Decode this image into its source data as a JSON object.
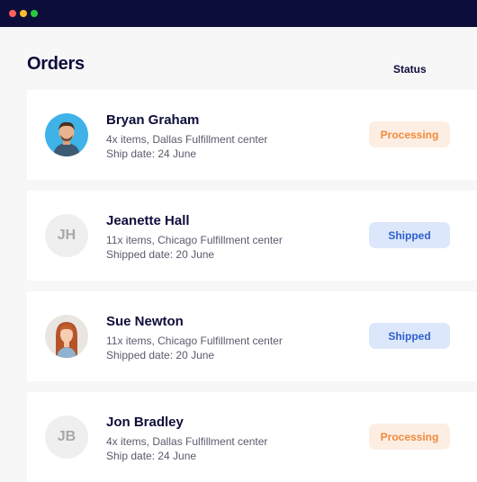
{
  "window": {
    "controls": [
      "close",
      "minimize",
      "maximize"
    ]
  },
  "header": {
    "title": "Orders",
    "status_column": "Status"
  },
  "orders": [
    {
      "name": "Bryan Graham",
      "items": "4x items, Dallas Fulfillment center",
      "date": "Ship date: 24 June",
      "status": "Processing",
      "status_color": "#f08a3c",
      "avatar": "photo-man"
    },
    {
      "name": "Jeanette Hall",
      "initials": "JH",
      "items": "11x items, Chicago Fulfillment center",
      "date": "Shipped date: 20 June",
      "status": "Shipped",
      "status_color": "#2f5fcc",
      "avatar": "initials"
    },
    {
      "name": "Sue Newton",
      "items": "11x items, Chicago Fulfillment center",
      "date": "Shipped date: 20 June",
      "status": "Shipped",
      "status_color": "#2f5fcc",
      "avatar": "photo-woman"
    },
    {
      "name": "Jon Bradley",
      "initials": "JB",
      "items": "4x items, Dallas Fulfillment center",
      "date": "Ship date: 24 June",
      "status": "Processing",
      "status_color": "#f08a3c",
      "avatar": "initials"
    }
  ],
  "colors": {
    "titlebar": "#0d0d3b",
    "processing_bg": "#fdeee3",
    "shipped_bg": "#dde7fb"
  }
}
